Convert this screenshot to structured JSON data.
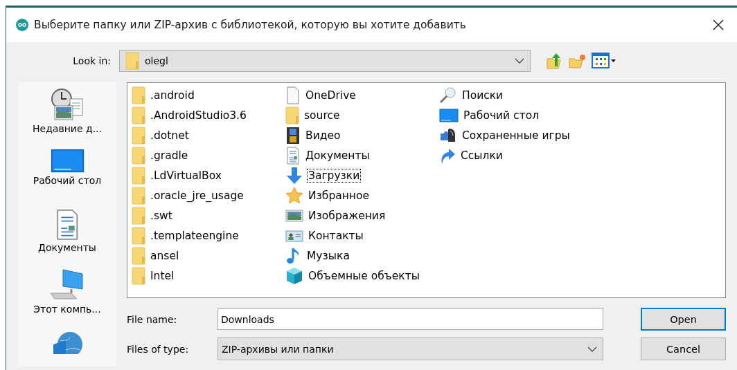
{
  "window": {
    "title": "Выберите папку или ZIP-архив с библиотекой, которую вы хотите добавить"
  },
  "look_in": {
    "label": "Look in:",
    "value": "olegl"
  },
  "toolbar": {
    "buttons": [
      {
        "kind": "up"
      },
      {
        "kind": "new_folder"
      },
      {
        "kind": "view"
      }
    ]
  },
  "sidebar": {
    "items": [
      {
        "kind": "recent",
        "label": "Недавние д..."
      },
      {
        "kind": "desktop",
        "label": "Рабочий стол"
      },
      {
        "kind": "document",
        "label": "Документы"
      },
      {
        "kind": "computer",
        "label": "Этот компь..."
      },
      {
        "kind": "network"
      }
    ]
  },
  "files": {
    "columns": [
      [
        {
          "kind": "folder",
          "name": ".android",
          "focused": false
        },
        {
          "kind": "folder",
          "name": ".AndroidStudio3.6",
          "focused": false
        },
        {
          "kind": "folder",
          "name": ".dotnet",
          "focused": false
        },
        {
          "kind": "folder",
          "name": ".gradle",
          "focused": false
        },
        {
          "kind": "folder",
          "name": ".LdVirtualBox",
          "focused": false
        },
        {
          "kind": "folder",
          "name": ".oracle_jre_usage",
          "focused": false
        },
        {
          "kind": "folder",
          "name": ".swt",
          "focused": false
        },
        {
          "kind": "folder",
          "name": ".templateengine",
          "focused": false
        },
        {
          "kind": "folder",
          "name": "ansel",
          "focused": false
        },
        {
          "kind": "folder",
          "name": "Intel",
          "focused": false
        }
      ],
      [
        {
          "kind": "file",
          "name": "OneDrive",
          "focused": false
        },
        {
          "kind": "folder",
          "name": "source",
          "focused": false
        },
        {
          "kind": "video",
          "name": "Видео",
          "focused": false
        },
        {
          "kind": "document",
          "name": "Документы",
          "focused": false
        },
        {
          "kind": "download",
          "name": "Загрузки",
          "focused": true
        },
        {
          "kind": "star",
          "name": "Избранное",
          "focused": false
        },
        {
          "kind": "image",
          "name": "Изображения",
          "focused": false
        },
        {
          "kind": "contacts",
          "name": "Контакты",
          "focused": false
        },
        {
          "kind": "music",
          "name": "Музыка",
          "focused": false
        },
        {
          "kind": "cube",
          "name": "Объемные объекты",
          "focused": false
        }
      ],
      [
        {
          "kind": "search",
          "name": "Поиски",
          "focused": false
        },
        {
          "kind": "desktop",
          "name": "Рабочий стол",
          "focused": false
        },
        {
          "kind": "games",
          "name": "Сохраненные игры",
          "focused": false
        },
        {
          "kind": "link",
          "name": "Ссылки",
          "focused": false
        }
      ]
    ]
  },
  "file_name": {
    "label": "File name:",
    "value": "Downloads"
  },
  "file_type": {
    "label": "Files of type:",
    "value": "ZIP-архивы или папки"
  },
  "buttons": [
    {
      "label": "Open",
      "default": true
    },
    {
      "label": "Cancel",
      "default": false
    }
  ]
}
